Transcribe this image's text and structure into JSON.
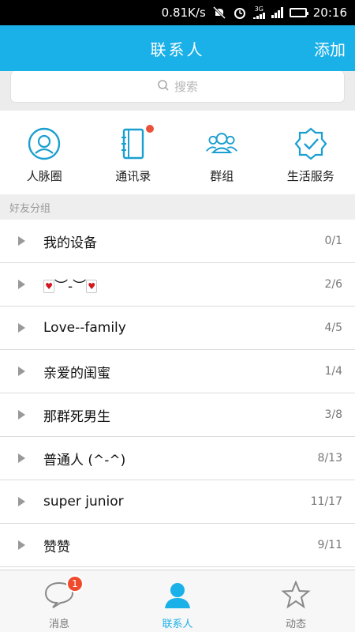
{
  "status_bar": {
    "speed": "0.81K/s",
    "network": "3G",
    "time": "20:16"
  },
  "header": {
    "title": "联系人",
    "add_label": "添加"
  },
  "search": {
    "placeholder": "搜索"
  },
  "quick_links": [
    {
      "label": "人脉圈",
      "icon": "person-circle-icon"
    },
    {
      "label": "通讯录",
      "icon": "address-book-icon"
    },
    {
      "label": "群组",
      "icon": "group-icon"
    },
    {
      "label": "生活服务",
      "icon": "service-badge-icon"
    }
  ],
  "section": {
    "title": "好友分组"
  },
  "groups": [
    {
      "name": "我的设备",
      "count": "0/1"
    },
    {
      "name": "︶-︶",
      "count": "2/6"
    },
    {
      "name": "Love--family",
      "count": "4/5"
    },
    {
      "name": "亲爱的闺蜜",
      "count": "1/4"
    },
    {
      "name": "那群死男生",
      "count": "3/8"
    },
    {
      "name": "普通人 (^-^)",
      "count": "8/13"
    },
    {
      "name": "super junior",
      "count": "11/17"
    },
    {
      "name": "赞赞",
      "count": "9/11"
    }
  ],
  "tabs": [
    {
      "label": "消息",
      "badge": "1",
      "icon": "chat-bubble-icon"
    },
    {
      "label": "联系人",
      "icon": "contacts-icon"
    },
    {
      "label": "动态",
      "icon": "star-icon"
    }
  ],
  "colors": {
    "accent": "#1ab0e8",
    "badge": "#f04a2c"
  }
}
